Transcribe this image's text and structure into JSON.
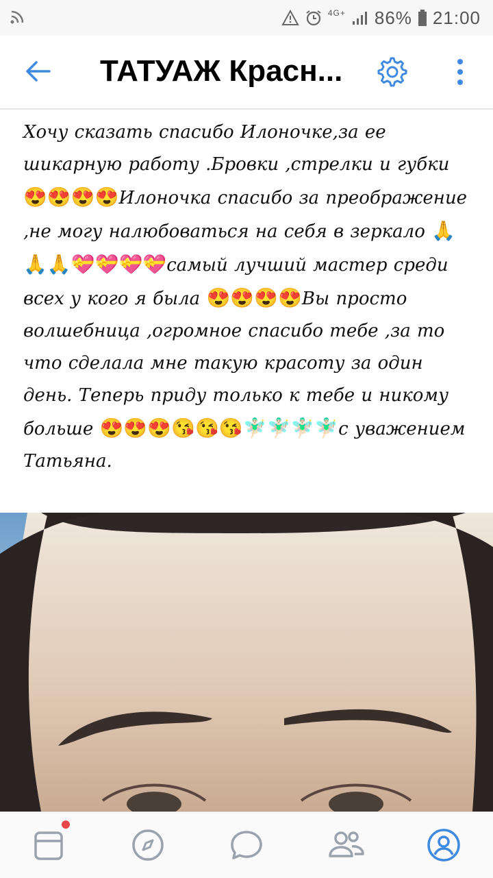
{
  "status_bar": {
    "network": "4G+",
    "battery": "86%",
    "time": "21:00"
  },
  "header": {
    "title": "ТАТУАЖ Красн...",
    "accent_color": "#3f8ae0"
  },
  "post": {
    "segments": [
      {
        "type": "text",
        "value": "Хочу сказать спасибо Илоночке,за ее шикарную работу .Бровки ,стрелки и губки "
      },
      {
        "type": "emoji",
        "value": "😍😍😍😍"
      },
      {
        "type": "text",
        "value": "Илоночка спасибо за преображение ,не могу налюбоваться на себя в зеркало "
      },
      {
        "type": "emoji",
        "value": "🙏🙏🙏💝💝💝💝"
      },
      {
        "type": "text",
        "value": "самый лучший мастер среди всех у кого я была "
      },
      {
        "type": "emoji",
        "value": "😍😍😍😍"
      },
      {
        "type": "text",
        "value": "Вы просто волшебница ,огромное спасибо тебе ,за то что сделала мне такую красоту за один день. Теперь приду только к тебе и никому больше "
      },
      {
        "type": "emoji",
        "value": "😍😍😍😘😘😘🧚🏻‍♂️🧚🏻‍♂️🧚🏻‍♂️🧚🏻‍♂️"
      },
      {
        "type": "text",
        "value": "с уважением Татьяна."
      }
    ]
  },
  "photo": {
    "icon": "eyebrows-photo"
  },
  "bottom_nav": {
    "items": [
      {
        "name": "news",
        "icon": "newsfeed-icon",
        "badge": true
      },
      {
        "name": "discover",
        "icon": "compass-icon"
      },
      {
        "name": "messages",
        "icon": "chat-icon"
      },
      {
        "name": "friends",
        "icon": "friends-icon"
      },
      {
        "name": "profile",
        "icon": "profile-icon",
        "active": true
      }
    ],
    "badge_color": "#e64646",
    "icon_color": "#99a2ad"
  }
}
